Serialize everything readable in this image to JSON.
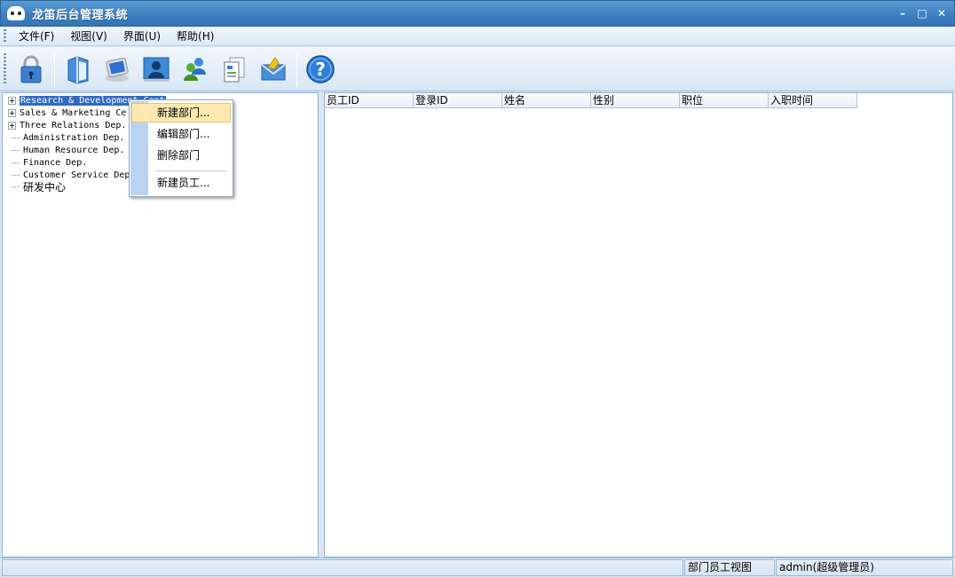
{
  "window": {
    "title": "龙笛后台管理系统"
  },
  "menu": [
    {
      "label": "文件(F)"
    },
    {
      "label": "视图(V)"
    },
    {
      "label": "界面(U)"
    },
    {
      "label": "帮助(H)"
    }
  ],
  "toolbar": {
    "buttons": [
      "lock-icon",
      "book-icon",
      "monitor-icon",
      "user-card-icon",
      "users-icon",
      "documents-icon",
      "mail-icon",
      "help-icon"
    ]
  },
  "tree": {
    "nodes": [
      {
        "label": "Research & Development Cent",
        "expandable": true,
        "selected": true
      },
      {
        "label": "Sales & Marketing Ce",
        "expandable": true
      },
      {
        "label": "Three Relations Dep.",
        "expandable": true
      },
      {
        "label": "Administration Dep.",
        "expandable": false
      },
      {
        "label": "Human Resource Dep.",
        "expandable": false
      },
      {
        "label": "Finance Dep.",
        "expandable": false
      },
      {
        "label": "Customer Service Dep",
        "expandable": false
      },
      {
        "label": "研发中心",
        "expandable": false
      }
    ]
  },
  "context_menu": {
    "items": [
      {
        "label": "新建部门...",
        "highlighted": true
      },
      {
        "label": "编辑部门..."
      },
      {
        "label": "删除部门"
      },
      {
        "label": "新建员工..."
      }
    ]
  },
  "grid": {
    "columns": [
      "员工ID",
      "登录ID",
      "姓名",
      "性别",
      "职位",
      "入职时间"
    ],
    "rows": []
  },
  "status": {
    "view": "部门员工视图",
    "user": "admin(超级管理员)"
  }
}
